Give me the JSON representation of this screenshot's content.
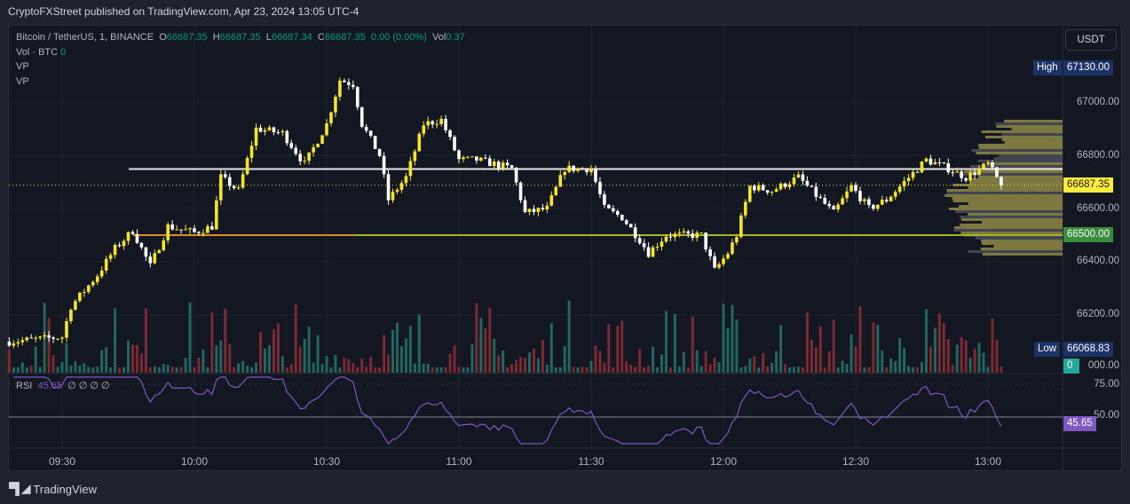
{
  "header": {
    "published": "CryptoFXStreet published on TradingView.com, Apr 23, 2024 13:05 UTC-4"
  },
  "legend": {
    "symbol": "Bitcoin / TetherUS, 1, BINANCE",
    "o_label": "O",
    "o": "66687.35",
    "h_label": "H",
    "h": "66687.35",
    "l_label": "L",
    "l": "66687.34",
    "c_label": "C",
    "c": "66687.35",
    "change": "0.00 (0.00%)",
    "vol_label": "Vol",
    "vol": "0.37",
    "vol_btc_label": "Vol · BTC",
    "vol_btc": "0",
    "vp1": "VP",
    "vp2": "VP"
  },
  "rsi_legend": {
    "label": "RSI",
    "value": "45.65",
    "nulls": "∅  ∅  ∅  ∅"
  },
  "currency": "USDT",
  "price_axis": [
    "67000.00",
    "66800.00",
    "66600.00",
    "66400.00",
    "66200.00"
  ],
  "price_axis_values": [
    67000,
    66800,
    66600,
    66400,
    66200
  ],
  "volume_axis_label": "000.00",
  "rsi_axis": [
    "75.00",
    "50.00"
  ],
  "tags": {
    "high_label": "High",
    "high": "67130.00",
    "current": "66687.35",
    "level": "66500.00",
    "low_label": "Low",
    "low": "66068.83",
    "volume": "0",
    "rsi": "45.65"
  },
  "levels": {
    "resistance": 66750,
    "support": 66500,
    "current": 66687.35
  },
  "time_axis": [
    "09:30",
    "10:00",
    "10:30",
    "11:00",
    "11:30",
    "12:00",
    "12:30",
    "13:00"
  ],
  "colors": {
    "up": "#f5e42a",
    "down": "#ffffff",
    "vol_up": "#22675e",
    "vol_down": "#7a2a30",
    "rsi": "#7e57c2",
    "accent": "#2962ff"
  },
  "price_path": [
    [
      "09:18",
      66100
    ],
    [
      "09:30",
      66117
    ],
    [
      "09:32",
      66233
    ],
    [
      "09:38",
      66350
    ],
    [
      "09:42",
      66450
    ],
    [
      "09:46",
      66517
    ],
    [
      "09:50",
      66383
    ],
    [
      "09:54",
      66533
    ],
    [
      "10:00",
      66510
    ],
    [
      "10:04",
      66533
    ],
    [
      "10:06",
      66717
    ],
    [
      "10:10",
      66667
    ],
    [
      "10:14",
      66900
    ],
    [
      "10:20",
      66883
    ],
    [
      "10:25",
      66767
    ],
    [
      "10:30",
      66917
    ],
    [
      "10:33",
      67083
    ],
    [
      "10:36",
      67067
    ],
    [
      "10:38",
      66917
    ],
    [
      "10:42",
      66800
    ],
    [
      "10:44",
      66633
    ],
    [
      "10:48",
      66717
    ],
    [
      "10:52",
      66917
    ],
    [
      "10:56",
      66933
    ],
    [
      "11:00",
      66783
    ],
    [
      "11:04",
      66783
    ],
    [
      "11:08",
      66767
    ],
    [
      "11:12",
      66750
    ],
    [
      "11:15",
      66583
    ],
    [
      "11:20",
      66600
    ],
    [
      "11:24",
      66750
    ],
    [
      "11:30",
      66750
    ],
    [
      "11:33",
      66600
    ],
    [
      "11:37",
      66567
    ],
    [
      "11:41",
      66483
    ],
    [
      "11:43",
      66433
    ],
    [
      "11:47",
      66500
    ],
    [
      "11:55",
      66500
    ],
    [
      "11:58",
      66367
    ],
    [
      "12:01",
      66433
    ],
    [
      "12:03",
      66500
    ],
    [
      "12:06",
      66683
    ],
    [
      "12:11",
      66667
    ],
    [
      "12:17",
      66717
    ],
    [
      "12:21",
      66650
    ],
    [
      "12:25",
      66583
    ],
    [
      "12:29",
      66683
    ],
    [
      "12:33",
      66600
    ],
    [
      "12:37",
      66633
    ],
    [
      "12:43",
      66733
    ],
    [
      "12:46",
      66783
    ],
    [
      "12:51",
      66750
    ],
    [
      "12:55",
      66717
    ],
    [
      "13:00",
      66767
    ],
    [
      "13:03",
      66687.35
    ]
  ],
  "footer": {
    "brand": "TradingView"
  }
}
